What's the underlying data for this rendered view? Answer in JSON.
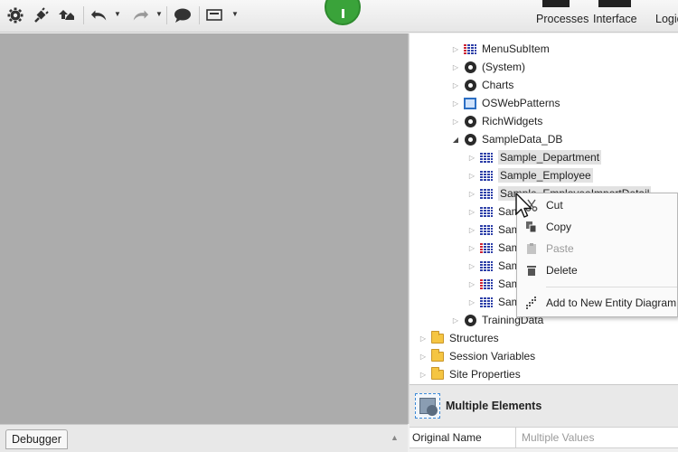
{
  "toolbar": {
    "icons": [
      "gear-icon",
      "plug-icon",
      "upload-icon",
      "undo-icon",
      "redo-icon",
      "comment-icon",
      "screen-icon"
    ],
    "tabs": [
      {
        "label": "Processes"
      },
      {
        "label": "Interface"
      },
      {
        "label": "Logic"
      }
    ],
    "run_button_color": "#3aa33a"
  },
  "tree": {
    "items": [
      {
        "label": "MenuSubItem",
        "icon": "entity-icon"
      },
      {
        "label": "(System)",
        "icon": "module-icon"
      },
      {
        "label": "Charts",
        "icon": "module-icon"
      },
      {
        "label": "OSWebPatterns",
        "icon": "web-module-icon"
      },
      {
        "label": "RichWidgets",
        "icon": "module-icon"
      },
      {
        "label": "SampleData_DB",
        "icon": "module-icon"
      },
      {
        "label": "Sample_Department",
        "icon": "entity-icon"
      },
      {
        "label": "Sample_Employee",
        "icon": "entity-icon"
      },
      {
        "label": "Sample_EmployeeImportDetail",
        "icon": "entity-icon"
      },
      {
        "label": "Sam",
        "icon": "entity-icon"
      },
      {
        "label": "Sam",
        "icon": "entity-icon"
      },
      {
        "label": "Sam",
        "icon": "entity-icon"
      },
      {
        "label": "Sam",
        "icon": "entity-icon"
      },
      {
        "label": "Sam",
        "icon": "entity-icon"
      },
      {
        "label": "Sam",
        "icon": "entity-icon"
      },
      {
        "label": "TrainingData",
        "icon": "module-icon"
      },
      {
        "label": "Structures",
        "icon": "folder-icon"
      },
      {
        "label": "Session Variables",
        "icon": "folder-icon"
      },
      {
        "label": "Site Properties",
        "icon": "folder-icon"
      }
    ]
  },
  "context_menu": {
    "items": [
      {
        "label": "Cut",
        "icon": "scissors-icon",
        "enabled": true
      },
      {
        "label": "Copy",
        "icon": "copy-icon",
        "enabled": true
      },
      {
        "label": "Paste",
        "icon": "paste-icon",
        "enabled": false
      },
      {
        "label": "Delete",
        "icon": "trash-icon",
        "enabled": true
      },
      {
        "label": "Add to New Entity Diagram",
        "icon": "diagram-icon",
        "enabled": true
      }
    ]
  },
  "bottom": {
    "debugger_tab": "Debugger"
  },
  "properties": {
    "title": "Multiple Elements",
    "rows": [
      {
        "key": "Original Name",
        "value": "Multiple Values"
      }
    ]
  }
}
